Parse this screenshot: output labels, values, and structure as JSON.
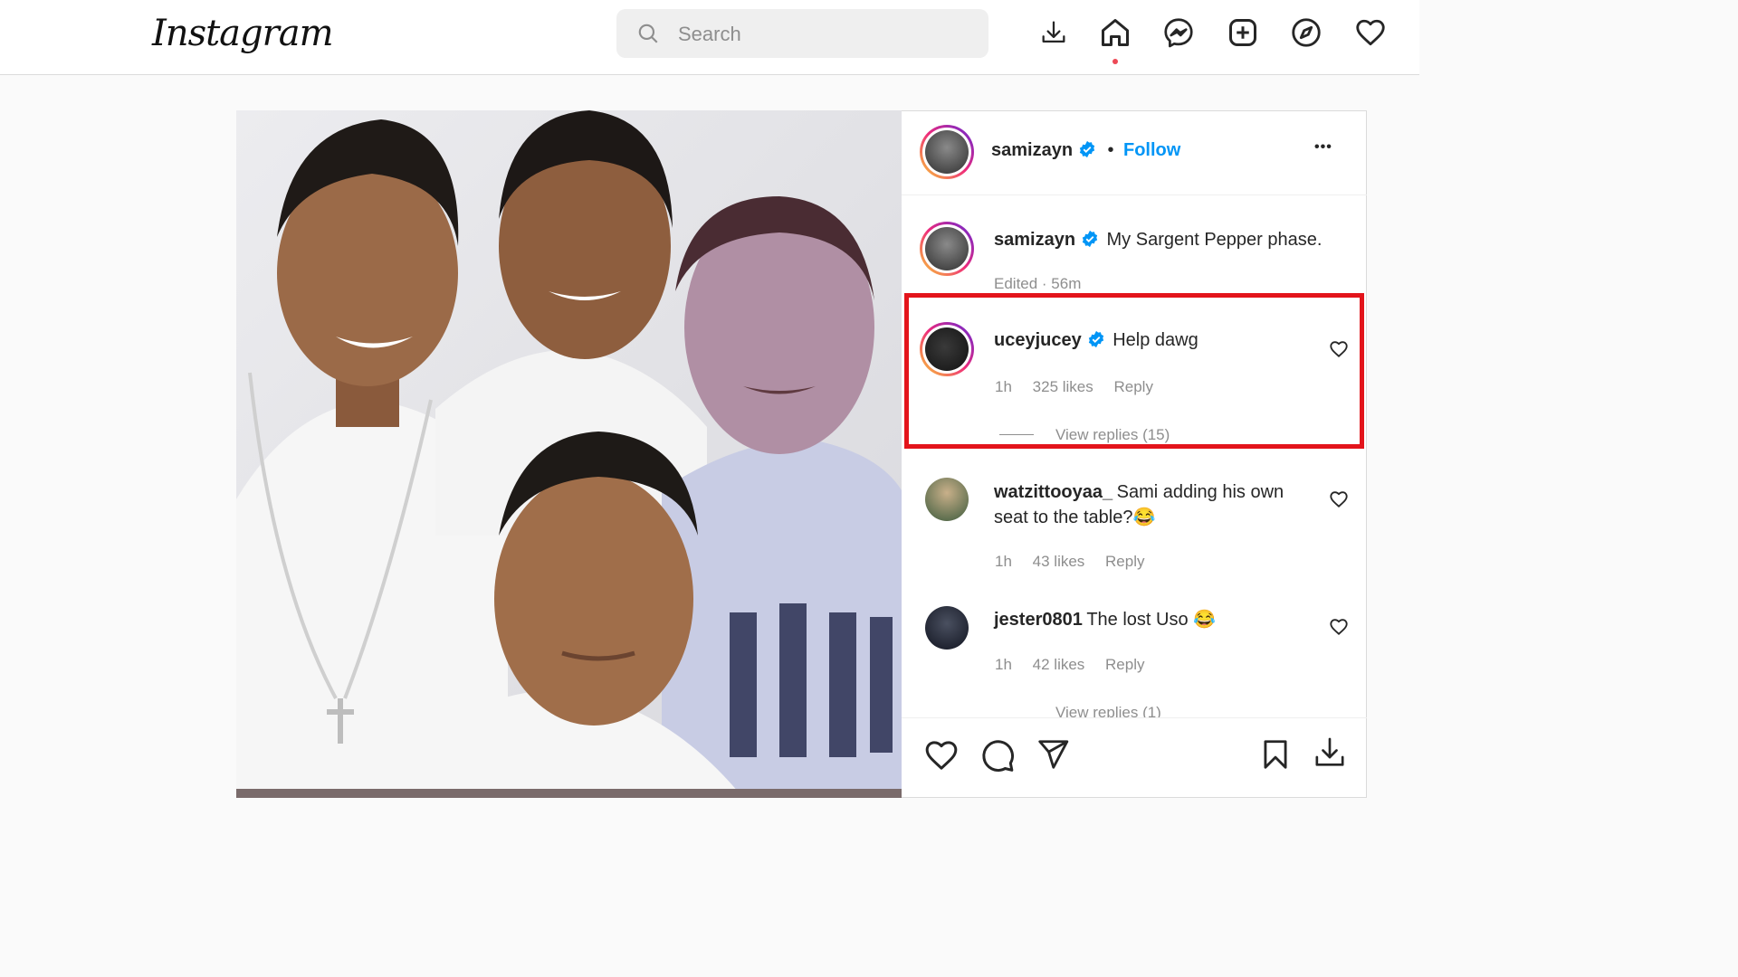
{
  "header": {
    "logo": "Instagram",
    "search_placeholder": "Search"
  },
  "nav_icons": [
    "download-icon",
    "home-icon",
    "messenger-icon",
    "new-post-icon",
    "explore-icon",
    "heart-icon"
  ],
  "post": {
    "author": "samizayn",
    "follow_label": "Follow",
    "separator": "•",
    "more_label": "•••"
  },
  "caption": {
    "username": "samizayn",
    "text": "My Sargent Pepper phase.",
    "meta": "Edited · 56m"
  },
  "comments": [
    {
      "username": "uceyjucey",
      "verified": true,
      "text": "Help dawg",
      "time": "1h",
      "likes": "325 likes",
      "reply": "Reply",
      "view_replies": "View replies (15)"
    },
    {
      "username": "watzittooyaa_",
      "verified": false,
      "text": "Sami adding his own seat to the table?😂",
      "time": "1h",
      "likes": "43 likes",
      "reply": "Reply"
    },
    {
      "username": "jester0801",
      "verified": false,
      "text": "The lost Uso 😂",
      "time": "1h",
      "likes": "42 likes",
      "reply": "Reply",
      "view_replies": "View replies (1)"
    }
  ],
  "colors": {
    "accent_blue": "#0095f6",
    "highlight_red": "#e3141b",
    "notification_dot": "#ed4956"
  }
}
